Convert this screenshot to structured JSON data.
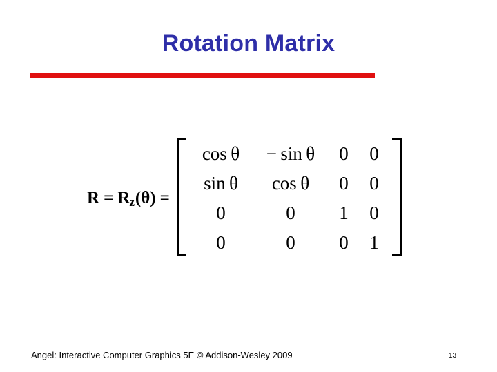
{
  "slide": {
    "title": "Rotation Matrix",
    "title_color": "#2e2ea8",
    "rule_color": "#e01010",
    "background_color": "#ffffff"
  },
  "equation": {
    "label_r": "R",
    "label_equals_1": "=",
    "label_r2": "R",
    "label_subscript": "z",
    "label_argument": "(θ)",
    "label_equals_2": "=",
    "matrix": {
      "rows": 4,
      "cols": 4,
      "cells": [
        [
          "cos θ",
          "− sin θ",
          "0",
          "0"
        ],
        [
          "sin θ",
          "cos θ",
          "0",
          "0"
        ],
        [
          "0",
          "0",
          "1",
          "0"
        ],
        [
          "0",
          "0",
          "0",
          "1"
        ]
      ]
    }
  },
  "footer": {
    "attribution": "Angel: Interactive Computer Graphics 5E © Addison-Wesley 2009",
    "page_number": "13"
  }
}
